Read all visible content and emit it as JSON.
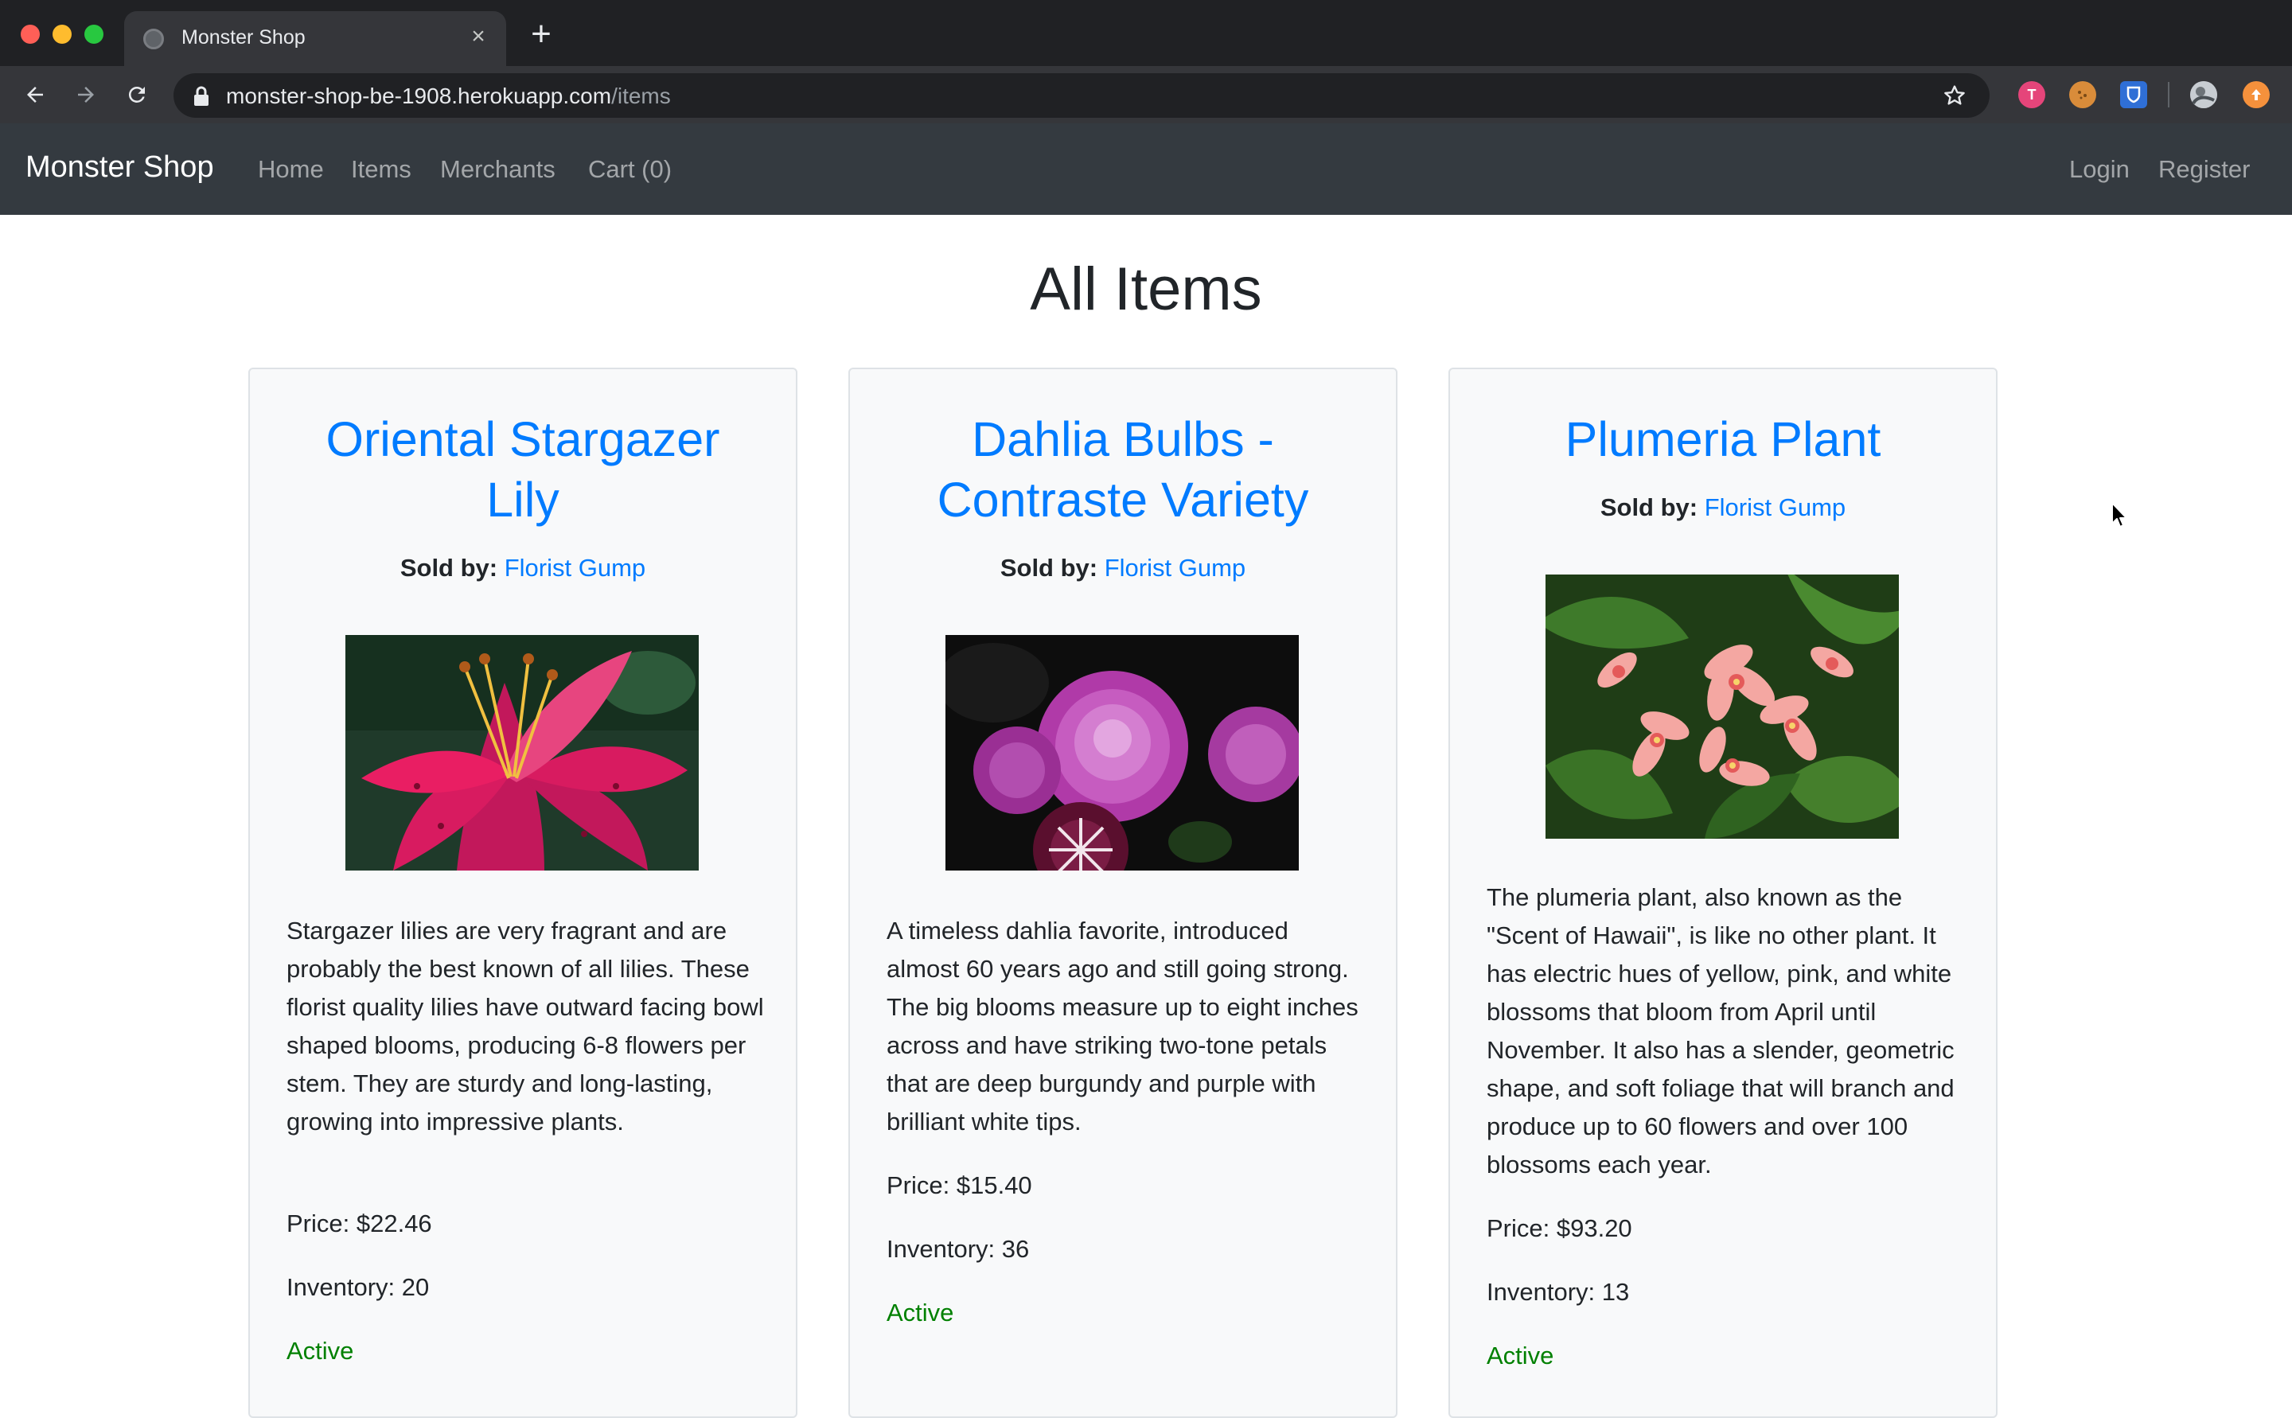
{
  "browser": {
    "tab_title": "Monster Shop",
    "url_host": "monster-shop-be-1908.herokuapp.com",
    "url_path": "/items",
    "extensions": [
      {
        "name": "extension-t-icon",
        "color": "#e5457a"
      },
      {
        "name": "extension-cookie-icon",
        "color": "#d98c3a"
      },
      {
        "name": "extension-shield-icon",
        "color": "#2f6fd6"
      },
      {
        "name": "profile-avatar-icon",
        "color": "#9aa0a6"
      },
      {
        "name": "update-icon",
        "color": "#f5913c"
      }
    ]
  },
  "navbar": {
    "brand": "Monster Shop",
    "links": [
      "Home",
      "Items",
      "Merchants",
      "Cart (0)"
    ],
    "right_links": [
      "Login",
      "Register"
    ]
  },
  "page": {
    "title": "All Items"
  },
  "items": [
    {
      "name_line1": "Oriental Stargazer",
      "name_line2": "Lily",
      "sold_by_label": "Sold by:",
      "merchant": "Florist Gump",
      "image": "pink-lily-photo",
      "description": "Stargazer lilies are very fragrant and are probably the best known of all lilies. These florist quality lilies have outward facing bowl shaped blooms, producing 6-8 flowers per stem. They are sturdy and long-lasting, growing into impressive plants.",
      "price": "Price: $22.46",
      "inventory": "Inventory: 20",
      "status": "Active"
    },
    {
      "name_line1": "Dahlia Bulbs -",
      "name_line2": "Contraste Variety",
      "sold_by_label": "Sold by:",
      "merchant": "Florist Gump",
      "image": "purple-dahlia-photo",
      "description": "A timeless dahlia favorite, introduced almost 60 years ago and still going strong. The big blooms measure up to eight inches across and have striking two-tone petals that are deep burgundy and purple with brilliant white tips.",
      "price": "Price: $15.40",
      "inventory": "Inventory: 36",
      "status": "Active"
    },
    {
      "name_line1": "Plumeria Plant",
      "name_line2": "",
      "sold_by_label": "Sold by:",
      "merchant": "Florist Gump",
      "image": "plumeria-flowers-photo",
      "description": "The plumeria plant, also known as the \"Scent of Hawaii\", is like no other plant. It has electric hues of yellow, pink, and white blossoms that bloom from April until November. It also has a slender, geometric shape, and soft foliage that will branch and produce up to 60 flowers and over 100 blossoms each year.",
      "price": "Price: $93.20",
      "inventory": "Inventory: 13",
      "status": "Active"
    }
  ],
  "colors": {
    "link": "#007bff",
    "navbar_bg": "#343a40",
    "card_bg": "#f8f9fa",
    "active": "#008000"
  }
}
